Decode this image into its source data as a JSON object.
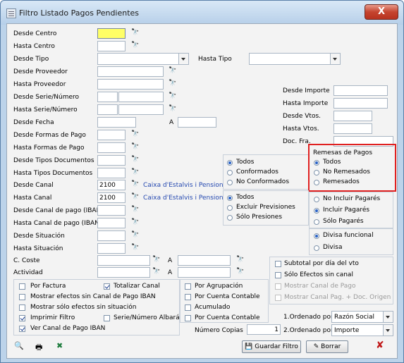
{
  "window": {
    "title": "Filtro Listado Pagos Pendientes",
    "close_label": "X"
  },
  "fields": {
    "desde_centro": "Desde Centro",
    "hasta_centro": "Hasta Centro",
    "desde_tipo": "Desde Tipo",
    "hasta_tipo": "Hasta Tipo",
    "desde_proveedor": "Desde Proveedor",
    "hasta_proveedor": "Hasta Proveedor",
    "desde_serie": "Desde Serie/Número",
    "hasta_serie": "Hasta Serie/Número",
    "desde_fecha": "Desde Fecha",
    "fecha_a": "A",
    "desde_formas": "Desde Formas de Pago",
    "hasta_formas": "Hasta Formas de Pago",
    "desde_tipos_doc": "Desde Tipos Documentos",
    "hasta_tipos_doc": "Hasta Tipos Documentos",
    "desde_canal": "Desde Canal",
    "hasta_canal": "Hasta Canal",
    "desde_canal_iban": "Desde Canal de pago (IBAN)",
    "hasta_canal_iban": "Hasta Canal de pago (IBAN)",
    "desde_situacion": "Desde Situación",
    "hasta_situacion": "Hasta Situación",
    "c_coste": "C. Coste",
    "actividad": "Actividad",
    "coste_a": "A",
    "actividad_a": "A",
    "desde_importe": "Desde Importe",
    "hasta_importe": "Hasta Importe",
    "desde_vtos": "Desde Vtos.",
    "hasta_vtos": "Hasta Vtos.",
    "doc_fra": "Doc. Fra."
  },
  "values": {
    "desde_canal": "2100",
    "hasta_canal": "2100",
    "canal_name_1": "Caixa d'Estalvis i Pensions",
    "canal_name_2": "Caixa d'Estalvis i Pensions"
  },
  "binoculars": "🔭",
  "estado_group": {
    "options": [
      "Todos",
      "Conformados",
      "No Conformados"
    ],
    "selected": 0
  },
  "remesas_group": {
    "title": "Remesas de Pagos",
    "options": [
      "Todos",
      "No Remesados",
      "Remesados"
    ],
    "selected": 0
  },
  "previsiones_group": {
    "options": [
      "Todos",
      "Excluir Previsiones",
      "Sólo Presiones"
    ],
    "selected": 0
  },
  "pagares_group": {
    "options": [
      "No Incluir Pagarés",
      "Incluir Pagarés",
      "Sólo Pagarés"
    ],
    "selected": 1
  },
  "divisa_group": {
    "options": [
      "Divisa funcional",
      "Divisa"
    ],
    "selected": 0
  },
  "checks": {
    "por_factura": "Por Factura",
    "totalizar_canal": "Totalizar Canal",
    "por_agrupacion": "Por Agrupación",
    "mostrar_sin_canal": "Mostrar efectos sin Canal de Pago IBAN",
    "por_cuenta_contable": "Por Cuenta Contable",
    "mostrar_solo_situacion": "Mostrar sólo efectos sin situación",
    "acumulado": "Acumulado",
    "imprimir_filtro": "Imprimir Filtro",
    "serie_albaran": "Serie/Número Albarán",
    "por_cuenta_contable2": "Por Cuenta Contable",
    "ver_canal_iban": "Ver Canal de Pago IBAN",
    "subtotal_dia": "Subtotal por día del vto",
    "solo_sin_canal": "Sólo Efectos sin canal",
    "mostrar_canal_pago": "Mostrar Canal de Pago",
    "mostrar_canal_pag_doc": "Mostrar Canal Pag. + Doc. Origen"
  },
  "ordering": {
    "ordenado1_label": "1.Ordenado por",
    "ordenado1_value": "Razón Social",
    "ordenado2_label": "2.Ordenado por",
    "ordenado2_value": "Importe",
    "copias_label": "Número Copias",
    "copias_value": "1"
  },
  "buttons": {
    "guardar": "Guardar Filtro",
    "borrar": "Borrar"
  }
}
